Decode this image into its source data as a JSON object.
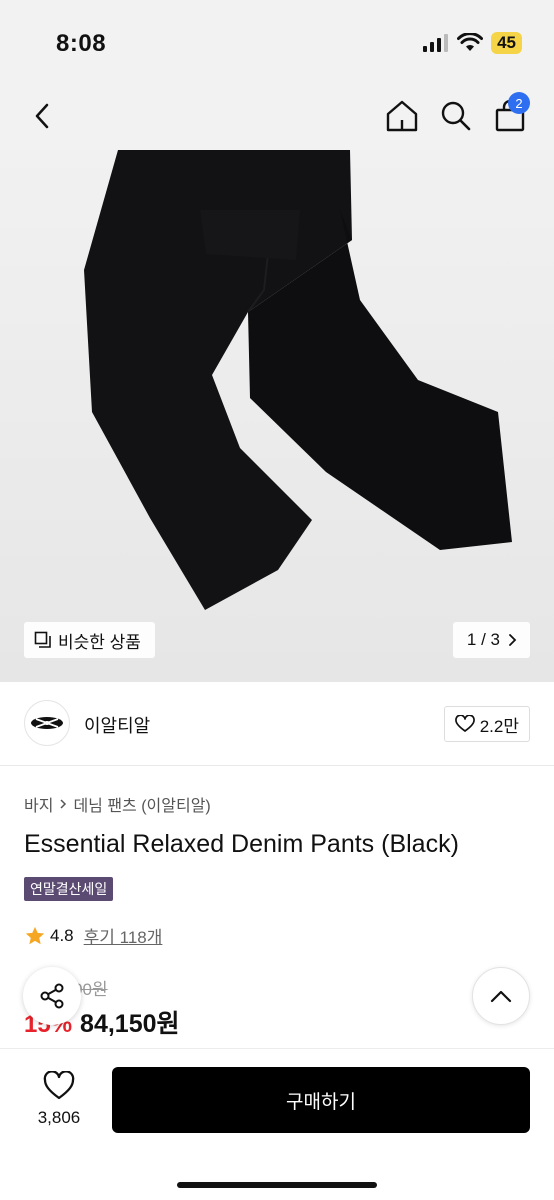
{
  "status_bar": {
    "time": "8:08",
    "battery": "45"
  },
  "header": {
    "cart_count": "2"
  },
  "hero": {
    "similar_label": "비슷한 상품",
    "pager": "1 / 3"
  },
  "brand": {
    "name": "이알티알",
    "likes": "2.2만"
  },
  "breadcrumb": [
    "바지",
    "데님 팬츠 (이알티알)"
  ],
  "product": {
    "title": "Essential Relaxed Denim Pants (Black)",
    "badge": "연말결산세일",
    "rating": "4.8",
    "reviews": "후기 118개",
    "original_price": "99,000원",
    "discount": "15%",
    "price": "84,150원"
  },
  "bottom": {
    "wish_count": "3,806",
    "buy_label": "구매하기"
  },
  "colors": {
    "badge": "#5b4b73",
    "discount": "#e8232c",
    "cart_badge": "#2d6ff0",
    "star": "#f5a623"
  },
  "icons": [
    "back-icon",
    "home-icon",
    "search-icon",
    "cart-icon",
    "share-icon",
    "chevron-up-icon",
    "heart-icon",
    "star-icon"
  ]
}
